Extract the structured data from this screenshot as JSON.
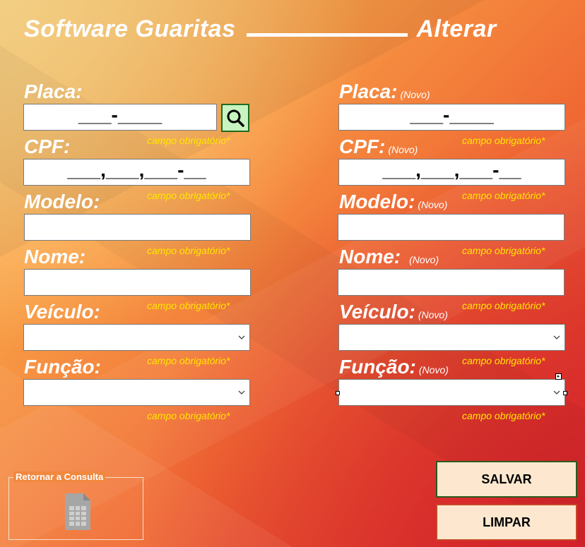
{
  "title": {
    "left": "Software Guaritas",
    "right": "Alterar"
  },
  "required_text": "campo obrigatório*",
  "novo_text": "(Novo)",
  "left": {
    "placa_label": "Placa:",
    "placa_mask": "___-____",
    "cpf_label": "CPF:",
    "cpf_mask": "___,___,___-__",
    "modelo_label": "Modelo:",
    "nome_label": "Nome:",
    "veiculo_label": "Veículo:",
    "funcao_label": "Função:"
  },
  "right": {
    "placa_label": "Placa:",
    "placa_mask": "___-____",
    "cpf_label": "CPF:",
    "cpf_mask": "___,___,___-__",
    "modelo_label": "Modelo:",
    "nome_label": "Nome:",
    "veiculo_label": "Veículo:",
    "funcao_label": "Função:"
  },
  "icons": {
    "search": "search-icon",
    "dropdown": "chevron-down-icon",
    "sheet": "spreadsheet-icon"
  },
  "buttons": {
    "save": "SALVAR",
    "clear": "LIMPAR"
  },
  "return_frame": {
    "legend": "Retornar a Consulta"
  },
  "colors": {
    "required": "#ffe600",
    "save_border": "#2c5a1e",
    "clear_border": "#c8462a",
    "search_bg": "#c8f4c0"
  }
}
